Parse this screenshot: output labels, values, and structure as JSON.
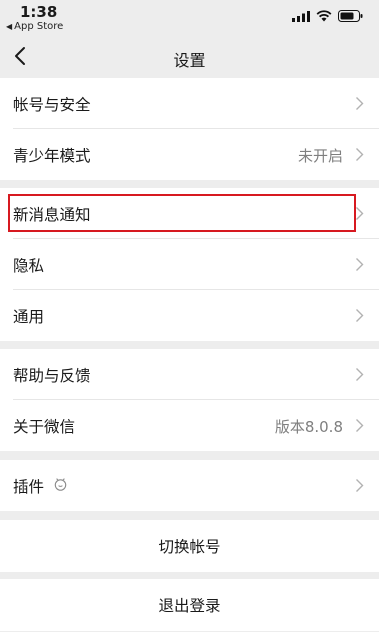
{
  "status_bar": {
    "time": "1:38",
    "back_app": "App Store"
  },
  "nav": {
    "title": "设置",
    "back_icon": "chevron-left-icon"
  },
  "rows": {
    "account_security": {
      "label": "帐号与安全"
    },
    "youth_mode": {
      "label": "青少年模式",
      "value": "未开启"
    },
    "new_message_notify": {
      "label": "新消息通知"
    },
    "privacy": {
      "label": "隐私"
    },
    "general": {
      "label": "通用"
    },
    "help_feedback": {
      "label": "帮助与反馈"
    },
    "about_wechat": {
      "label": "关于微信",
      "value": "版本8.0.8"
    },
    "plugins": {
      "label": "插件",
      "icon": "plugin-icon"
    }
  },
  "actions": {
    "switch_account": "切换帐号",
    "logout": "退出登录"
  },
  "colors": {
    "background": "#ededed",
    "row": "#ffffff",
    "highlight": "#d71920",
    "secondary_text": "#7f7f7f"
  }
}
